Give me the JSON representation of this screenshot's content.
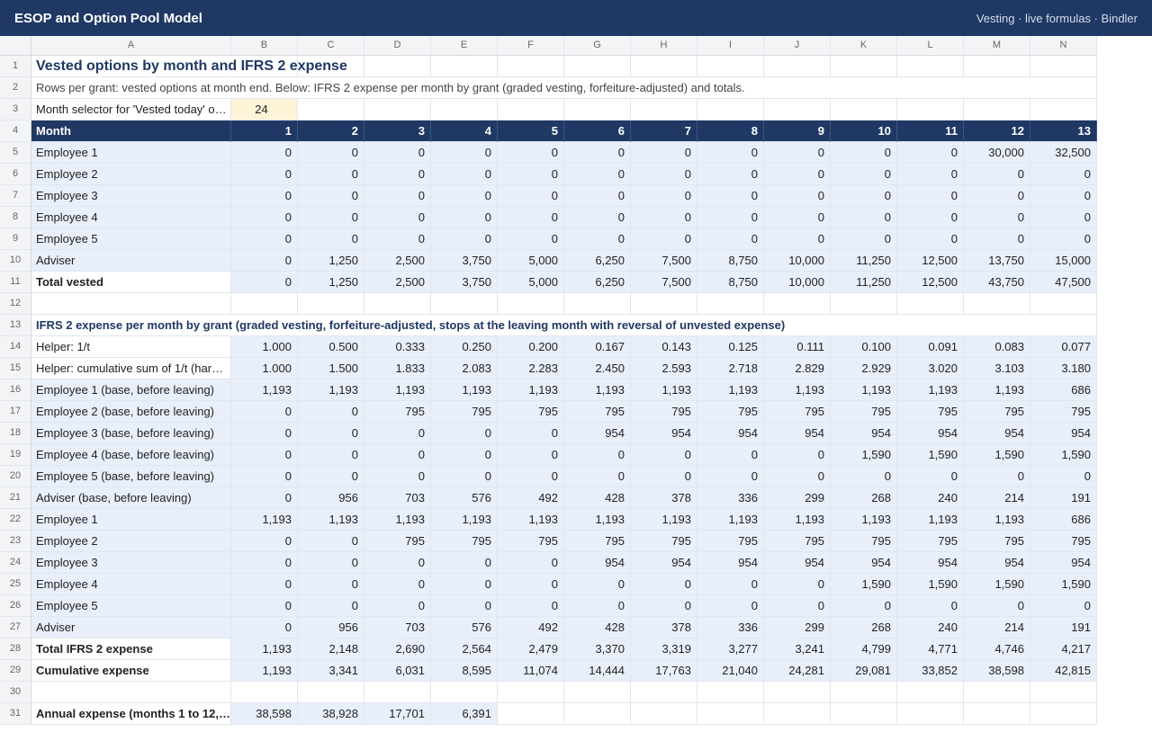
{
  "app": {
    "title": "ESOP and Option Pool Model",
    "subtitle": "Vesting · live formulas · Bindler"
  },
  "columns": [
    "A",
    "B",
    "C",
    "D",
    "E",
    "F",
    "G",
    "H",
    "I",
    "J",
    "K",
    "L",
    "M",
    "N"
  ],
  "sheet": {
    "title": "Vested options by month and IFRS 2 expense",
    "note": "Rows per grant: vested options at month end. Below: IFRS 2 expense per month by grant (graded vesting, forfeiture-adjusted) and totals.",
    "selector_label": "Month selector for 'Vested today' o…",
    "selector_value": "24",
    "month_label": "Month",
    "months": [
      "1",
      "2",
      "3",
      "4",
      "5",
      "6",
      "7",
      "8",
      "9",
      "10",
      "11",
      "12",
      "13"
    ],
    "vested_rows": [
      {
        "label": "Employee 1",
        "values": [
          "0",
          "0",
          "0",
          "0",
          "0",
          "0",
          "0",
          "0",
          "0",
          "0",
          "0",
          "30,000",
          "32,500"
        ]
      },
      {
        "label": "Employee 2",
        "values": [
          "0",
          "0",
          "0",
          "0",
          "0",
          "0",
          "0",
          "0",
          "0",
          "0",
          "0",
          "0",
          "0"
        ]
      },
      {
        "label": "Employee 3",
        "values": [
          "0",
          "0",
          "0",
          "0",
          "0",
          "0",
          "0",
          "0",
          "0",
          "0",
          "0",
          "0",
          "0"
        ]
      },
      {
        "label": "Employee 4",
        "values": [
          "0",
          "0",
          "0",
          "0",
          "0",
          "0",
          "0",
          "0",
          "0",
          "0",
          "0",
          "0",
          "0"
        ]
      },
      {
        "label": "Employee 5",
        "values": [
          "0",
          "0",
          "0",
          "0",
          "0",
          "0",
          "0",
          "0",
          "0",
          "0",
          "0",
          "0",
          "0"
        ]
      },
      {
        "label": "Adviser",
        "values": [
          "0",
          "1,250",
          "2,500",
          "3,750",
          "5,000",
          "6,250",
          "7,500",
          "8,750",
          "10,000",
          "11,250",
          "12,500",
          "13,750",
          "15,000"
        ]
      }
    ],
    "total_vested": {
      "label": "Total vested",
      "values": [
        "0",
        "1,250",
        "2,500",
        "3,750",
        "5,000",
        "6,250",
        "7,500",
        "8,750",
        "10,000",
        "11,250",
        "12,500",
        "43,750",
        "47,500"
      ]
    },
    "section_title": "IFRS 2 expense per month by grant (graded vesting, forfeiture-adjusted, stops at the leaving month with reversal of unvested expense)",
    "helper_rows": [
      {
        "label": "Helper: 1/t",
        "values": [
          "1.000",
          "0.500",
          "0.333",
          "0.250",
          "0.200",
          "0.167",
          "0.143",
          "0.125",
          "0.111",
          "0.100",
          "0.091",
          "0.083",
          "0.077"
        ]
      },
      {
        "label": "Helper: cumulative sum of 1/t (har…",
        "values": [
          "1.000",
          "1.500",
          "1.833",
          "2.083",
          "2.283",
          "2.450",
          "2.593",
          "2.718",
          "2.829",
          "2.929",
          "3.020",
          "3.103",
          "3.180"
        ]
      }
    ],
    "base_rows": [
      {
        "label": "Employee 1 (base, before leaving)",
        "values": [
          "1,193",
          "1,193",
          "1,193",
          "1,193",
          "1,193",
          "1,193",
          "1,193",
          "1,193",
          "1,193",
          "1,193",
          "1,193",
          "1,193",
          "686"
        ]
      },
      {
        "label": "Employee 2 (base, before leaving)",
        "values": [
          "0",
          "0",
          "795",
          "795",
          "795",
          "795",
          "795",
          "795",
          "795",
          "795",
          "795",
          "795",
          "795"
        ]
      },
      {
        "label": "Employee 3 (base, before leaving)",
        "values": [
          "0",
          "0",
          "0",
          "0",
          "0",
          "954",
          "954",
          "954",
          "954",
          "954",
          "954",
          "954",
          "954"
        ]
      },
      {
        "label": "Employee 4 (base, before leaving)",
        "values": [
          "0",
          "0",
          "0",
          "0",
          "0",
          "0",
          "0",
          "0",
          "0",
          "1,590",
          "1,590",
          "1,590",
          "1,590"
        ]
      },
      {
        "label": "Employee 5 (base, before leaving)",
        "values": [
          "0",
          "0",
          "0",
          "0",
          "0",
          "0",
          "0",
          "0",
          "0",
          "0",
          "0",
          "0",
          "0"
        ]
      },
      {
        "label": "Adviser (base, before leaving)",
        "values": [
          "0",
          "956",
          "703",
          "576",
          "492",
          "428",
          "378",
          "336",
          "299",
          "268",
          "240",
          "214",
          "191"
        ]
      }
    ],
    "expense_rows": [
      {
        "label": "Employee 1",
        "values": [
          "1,193",
          "1,193",
          "1,193",
          "1,193",
          "1,193",
          "1,193",
          "1,193",
          "1,193",
          "1,193",
          "1,193",
          "1,193",
          "1,193",
          "686"
        ]
      },
      {
        "label": "Employee 2",
        "values": [
          "0",
          "0",
          "795",
          "795",
          "795",
          "795",
          "795",
          "795",
          "795",
          "795",
          "795",
          "795",
          "795"
        ]
      },
      {
        "label": "Employee 3",
        "values": [
          "0",
          "0",
          "0",
          "0",
          "0",
          "954",
          "954",
          "954",
          "954",
          "954",
          "954",
          "954",
          "954"
        ]
      },
      {
        "label": "Employee 4",
        "values": [
          "0",
          "0",
          "0",
          "0",
          "0",
          "0",
          "0",
          "0",
          "0",
          "1,590",
          "1,590",
          "1,590",
          "1,590"
        ]
      },
      {
        "label": "Employee 5",
        "values": [
          "0",
          "0",
          "0",
          "0",
          "0",
          "0",
          "0",
          "0",
          "0",
          "0",
          "0",
          "0",
          "0"
        ]
      },
      {
        "label": "Adviser",
        "values": [
          "0",
          "956",
          "703",
          "576",
          "492",
          "428",
          "378",
          "336",
          "299",
          "268",
          "240",
          "214",
          "191"
        ]
      }
    ],
    "total_expense": {
      "label": "Total IFRS 2 expense",
      "values": [
        "1,193",
        "2,148",
        "2,690",
        "2,564",
        "2,479",
        "3,370",
        "3,319",
        "3,277",
        "3,241",
        "4,799",
        "4,771",
        "4,746",
        "4,217"
      ]
    },
    "cumulative_expense": {
      "label": "Cumulative expense",
      "values": [
        "1,193",
        "3,341",
        "6,031",
        "8,595",
        "11,074",
        "14,444",
        "17,763",
        "21,040",
        "24,281",
        "29,081",
        "33,852",
        "38,598",
        "42,815"
      ]
    },
    "annual_expense": {
      "label": "Annual expense (months 1 to 12, …",
      "values": [
        "38,598",
        "38,928",
        "17,701",
        "6,391"
      ]
    }
  },
  "colors": {
    "header": "#1f3864",
    "band": "#e8effb",
    "input": "#fdf3d6"
  }
}
